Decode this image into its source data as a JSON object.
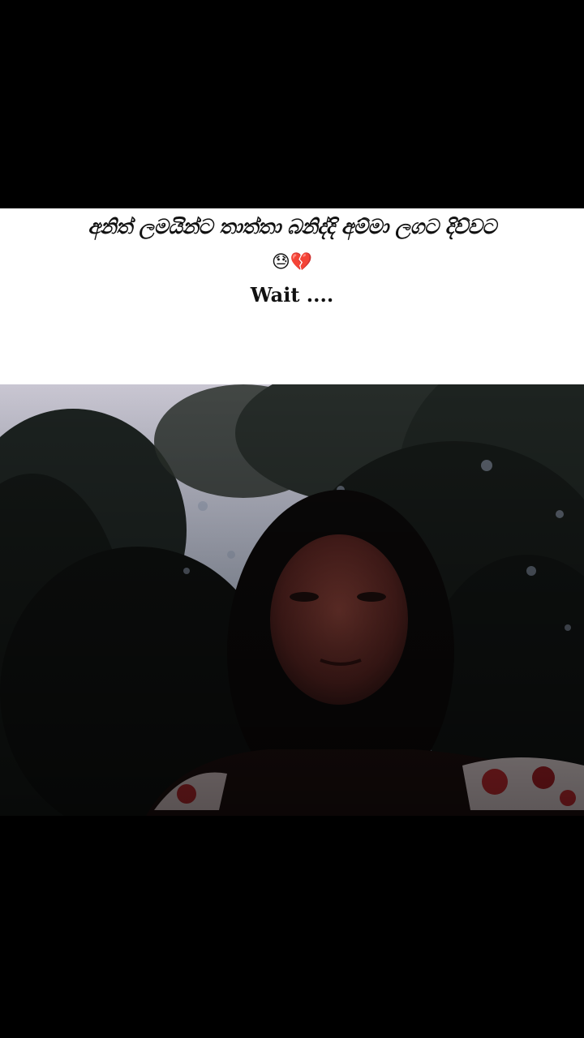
{
  "caption": {
    "title": "අනිත් ලමයින්ට තාත්තා බනිද්දි අම්මා ලගට දිව්වට",
    "emojis": "😓💔",
    "wait_text": "Wait ...."
  },
  "colors": {
    "background": "#000000",
    "caption_bg": "#ffffff",
    "caption_text": "#111111"
  }
}
